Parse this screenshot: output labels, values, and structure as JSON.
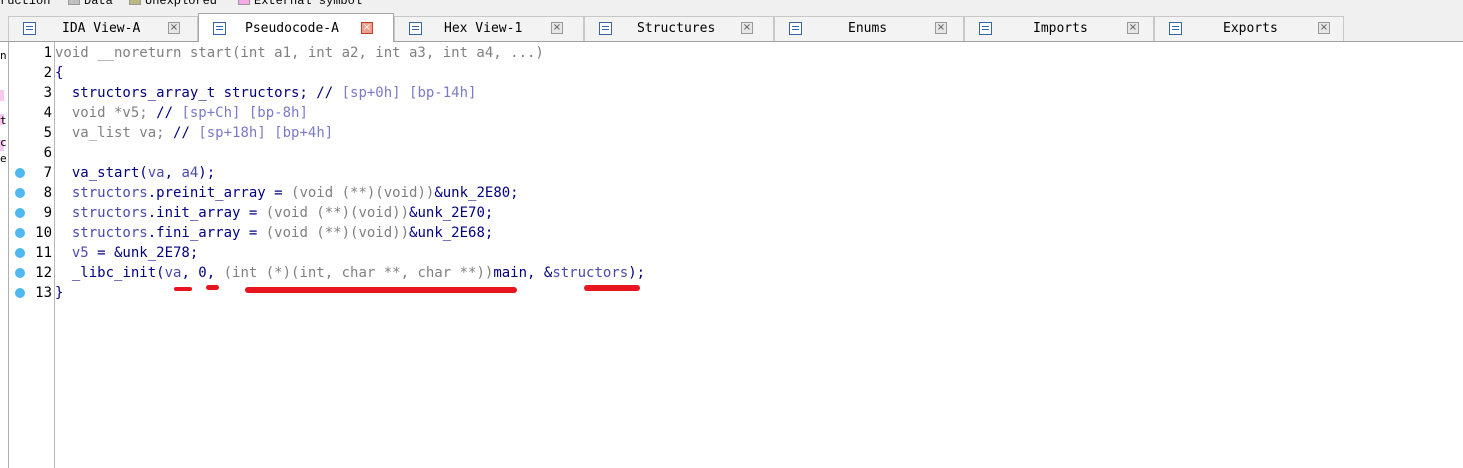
{
  "legend": {
    "items": [
      {
        "label": "ruction",
        "color": ""
      },
      {
        "label": "Data",
        "color": "#c0c0c0"
      },
      {
        "label": "Unexplored",
        "color": "#b8b880"
      },
      {
        "label": "External symbol",
        "color": "#f8a8e8"
      }
    ]
  },
  "tabs": [
    {
      "label": "IDA View-A",
      "icon": "disassembly-icon",
      "active": false
    },
    {
      "label": "Pseudocode-A",
      "icon": "pseudocode-icon",
      "active": true
    },
    {
      "label": "Hex View-1",
      "icon": "hex-icon",
      "active": false
    },
    {
      "label": "Structures",
      "icon": "structures-icon",
      "active": false
    },
    {
      "label": "Enums",
      "icon": "enums-icon",
      "active": false
    },
    {
      "label": "Imports",
      "icon": "imports-icon",
      "active": false
    },
    {
      "label": "Exports",
      "icon": "exports-icon",
      "active": false
    }
  ],
  "tab_close_glyph": "×",
  "left_panel_letters": [
    "n",
    "t",
    "c",
    "e"
  ],
  "code": {
    "line_numbers": [
      "1",
      "2",
      "3",
      "4",
      "5",
      "6",
      "7",
      "8",
      "9",
      "10",
      "11",
      "12",
      "13"
    ],
    "breakpoint_lines": [
      7,
      8,
      9,
      10,
      11,
      12,
      13
    ],
    "lines": [
      {
        "p": [
          [
            "g",
            "void __noreturn start(int a1, int a2, int a3, int a4, ...)"
          ]
        ]
      },
      {
        "p": [
          [
            "n",
            "{"
          ]
        ]
      },
      {
        "p": [
          [
            "n",
            "  structors_array_t structors; "
          ],
          [
            "n",
            "// "
          ],
          [
            "c",
            "[sp+0h] [bp-14h]"
          ]
        ]
      },
      {
        "p": [
          [
            "g",
            "  void *v5; "
          ],
          [
            "n",
            "// "
          ],
          [
            "c",
            "[sp+Ch] [bp-8h]"
          ]
        ]
      },
      {
        "p": [
          [
            "g",
            "  va_list va; "
          ],
          [
            "n",
            "// "
          ],
          [
            "c",
            "[sp+18h] [bp+4h]"
          ]
        ]
      },
      {
        "p": [
          [
            "n",
            ""
          ]
        ]
      },
      {
        "p": [
          [
            "n",
            "  va_start("
          ],
          [
            "v",
            "va"
          ],
          [
            "n",
            ", "
          ],
          [
            "v",
            "a4"
          ],
          [
            "n",
            ");"
          ]
        ]
      },
      {
        "p": [
          [
            "v",
            "  structors"
          ],
          [
            "n",
            ".preinit_array = "
          ],
          [
            "g",
            "(void (**)(void))"
          ],
          [
            "n",
            "&unk_2E80;"
          ]
        ]
      },
      {
        "p": [
          [
            "v",
            "  structors"
          ],
          [
            "n",
            ".init_array = "
          ],
          [
            "g",
            "(void (**)(void))"
          ],
          [
            "n",
            "&unk_2E70;"
          ]
        ]
      },
      {
        "p": [
          [
            "v",
            "  structors"
          ],
          [
            "n",
            ".fini_array = "
          ],
          [
            "g",
            "(void (**)(void))"
          ],
          [
            "n",
            "&unk_2E68;"
          ]
        ]
      },
      {
        "p": [
          [
            "v",
            "  v5"
          ],
          [
            "n",
            " = &unk_2E78;"
          ]
        ]
      },
      {
        "p": [
          [
            "n",
            "  _libc_init("
          ],
          [
            "v",
            "va"
          ],
          [
            "n",
            ", 0, "
          ],
          [
            "g",
            "(int (*)(int, char **, char **))"
          ],
          [
            "n",
            "main, &"
          ],
          [
            "v",
            "structors"
          ],
          [
            "n",
            ");"
          ]
        ]
      },
      {
        "p": [
          [
            "n",
            "}"
          ]
        ]
      }
    ]
  },
  "colors": {
    "accent": "#3566a8",
    "breakpoint": "#4fb8ef",
    "annotation_red": "#e8141e"
  }
}
